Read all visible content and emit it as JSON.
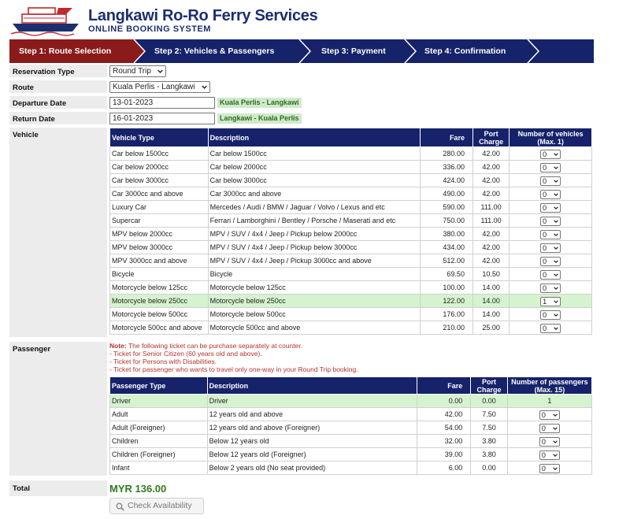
{
  "header": {
    "title": "Langkawi Ro-Ro Ferry Services",
    "subtitle": "ONLINE BOOKING SYSTEM",
    "logo_icon": "ferry-logo-icon"
  },
  "steps": [
    {
      "label": "Step 1: Route Selection",
      "active": true
    },
    {
      "label": "Step 2: Vehicles & Passengers",
      "active": false
    },
    {
      "label": "Step 3: Payment",
      "active": false
    },
    {
      "label": "Step 4: Confirmation",
      "active": false
    }
  ],
  "colors": {
    "navy": "#16236a",
    "active_step": "#8b1a1a",
    "highlight": "#d5f3cf",
    "total": "#2e7b1d"
  },
  "form": {
    "reservation_type": {
      "label": "Reservation Type",
      "value": "Round Trip"
    },
    "route": {
      "label": "Route",
      "value": "Kuala Perlis - Langkawi"
    },
    "departure": {
      "label": "Departure Date",
      "value": "13-01-2023",
      "tag": "Kuala Perlis - Langkawi"
    },
    "return": {
      "label": "Return Date",
      "value": "16-01-2023",
      "tag": "Langkawi - Kuala Perlis"
    }
  },
  "vehicle": {
    "label": "Vehicle",
    "headers": {
      "type": "Vehicle Type",
      "desc": "Description",
      "fare": "Fare",
      "port": "Port Charge",
      "count": "Number of vehicles (Max. 1)"
    },
    "rows": [
      {
        "type": "Car below 1500cc",
        "desc": "Car below 1500cc",
        "fare": "280.00",
        "port": "42.00",
        "qty": "0"
      },
      {
        "type": "Car below 2000cc",
        "desc": "Car below 2000cc",
        "fare": "336.00",
        "port": "42.00",
        "qty": "0"
      },
      {
        "type": "Car below 3000cc",
        "desc": "Car below 3000cc",
        "fare": "424.00",
        "port": "42.00",
        "qty": "0"
      },
      {
        "type": "Car 3000cc and above",
        "desc": "Car 3000cc and above",
        "fare": "490.00",
        "port": "42.00",
        "qty": "0"
      },
      {
        "type": "Luxury Car",
        "desc": "Mercedes / Audi / BMW / Jaguar / Volvo / Lexus and etc",
        "fare": "590.00",
        "port": "111.00",
        "qty": "0"
      },
      {
        "type": "Supercar",
        "desc": "Ferrari / Lamborghini / Bentley / Porsche / Maserati and etc",
        "fare": "750.00",
        "port": "111.00",
        "qty": "0"
      },
      {
        "type": "MPV below 2000cc",
        "desc": "MPV / SUV / 4x4 / Jeep / Pickup below 2000cc",
        "fare": "380.00",
        "port": "42.00",
        "qty": "0"
      },
      {
        "type": "MPV below 3000cc",
        "desc": "MPV / SUV / 4x4 / Jeep / Pickup below 3000cc",
        "fare": "434.00",
        "port": "42.00",
        "qty": "0"
      },
      {
        "type": "MPV 3000cc and above",
        "desc": "MPV / SUV / 4x4 / Jeep / Pickup 3000cc and above",
        "fare": "512.00",
        "port": "42.00",
        "qty": "0"
      },
      {
        "type": "Bicycle",
        "desc": "Bicycle",
        "fare": "69.50",
        "port": "10.50",
        "qty": "0"
      },
      {
        "type": "Motorcycle below 125cc",
        "desc": "Motorcycle below 125cc",
        "fare": "100.00",
        "port": "14.00",
        "qty": "0"
      },
      {
        "type": "Motorcycle below 250cc",
        "desc": "Motorcycle below 250cc",
        "fare": "122.00",
        "port": "14.00",
        "qty": "1",
        "highlight": true
      },
      {
        "type": "Motorcycle below 500cc",
        "desc": "Motorcycle below 500cc",
        "fare": "176.00",
        "port": "14.00",
        "qty": "0"
      },
      {
        "type": "Motorcycle 500cc and above",
        "desc": "Motorcycle 500cc and above",
        "fare": "210.00",
        "port": "25.00",
        "qty": "0"
      }
    ]
  },
  "passenger": {
    "label": "Passenger",
    "note_title": "Note:",
    "note_lines": [
      " The following ticket can be purchase separately at counter.",
      "- Ticket for Senior Citizen (60 years old and above).",
      "- Ticket for Persons with Disabilities.",
      "- Ticket for passenger who wants to travel only one-way in your Round Trip booking."
    ],
    "headers": {
      "type": "Passenger Type",
      "desc": "Description",
      "fare": "Fare",
      "port": "Port Charge",
      "count": "Number of passengers (Max. 15)"
    },
    "rows": [
      {
        "type": "Driver",
        "desc": "Driver",
        "fare": "0.00",
        "port": "0.00",
        "qty": "1",
        "fixed": true,
        "highlight": true
      },
      {
        "type": "Adult",
        "desc": "12 years old and above",
        "fare": "42.00",
        "port": "7.50",
        "qty": "0"
      },
      {
        "type": "Adult (Foreigner)",
        "desc": "12 years old and above (Foreigner)",
        "fare": "54.00",
        "port": "7.50",
        "qty": "0"
      },
      {
        "type": "Children",
        "desc": "Below 12 years old",
        "fare": "32.00",
        "port": "3.80",
        "qty": "0"
      },
      {
        "type": "Children (Foreigner)",
        "desc": "Below 12 years old (Foreigner)",
        "fare": "39.00",
        "port": "3.80",
        "qty": "0"
      },
      {
        "type": "Infant",
        "desc": "Below 2 years old (No seat provided)",
        "fare": "6.00",
        "port": "0.00",
        "qty": "0"
      }
    ]
  },
  "total": {
    "label": "Total",
    "amount": "MYR 136.00"
  },
  "check_button": {
    "label": "Check Availability",
    "icon": "search-icon"
  }
}
